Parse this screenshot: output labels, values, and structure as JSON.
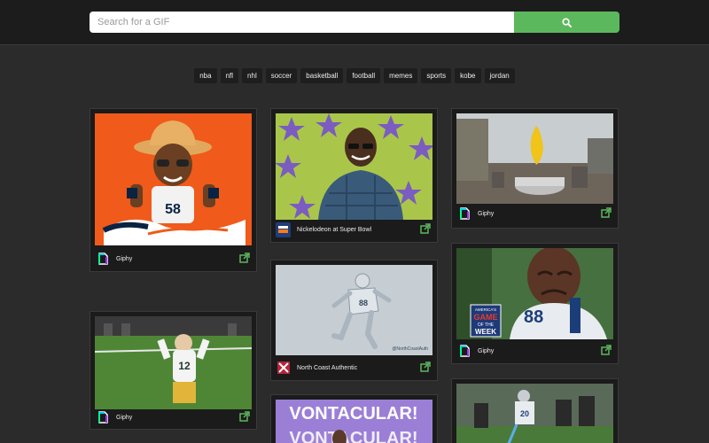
{
  "search": {
    "placeholder": "Search for a GIF",
    "button_icon": "search-icon"
  },
  "tags": [
    "nba",
    "nfl",
    "nhl",
    "soccer",
    "basketball",
    "football",
    "memes",
    "sports",
    "kobe",
    "jordan"
  ],
  "cards": [
    {
      "source": "Giphy",
      "source_icon": "giphy-logo-icon",
      "share_icon": "external-link-icon",
      "jersey": "58"
    },
    {
      "source": "Giphy",
      "source_icon": "giphy-logo-icon",
      "share_icon": "external-link-icon",
      "jersey": "12"
    },
    {
      "source": "Nickelodeon at Super Bowl",
      "source_icon": "nickelodeon-logo-icon",
      "share_icon": "external-link-icon"
    },
    {
      "source": "North Coast Authentic",
      "source_icon": "north-coast-logo-icon",
      "share_icon": "external-link-icon",
      "caption_text": "@NorthCoastAuth"
    },
    {
      "headline": "VONTACULAR!",
      "headline_echo": "VONTACULAR!"
    },
    {
      "source": "Giphy",
      "source_icon": "giphy-logo-icon",
      "share_icon": "external-link-icon"
    },
    {
      "source": "Giphy",
      "source_icon": "giphy-logo-icon",
      "share_icon": "external-link-icon",
      "jersey": "88",
      "badge_line1": "AMERICA'S",
      "badge_line2": "GAME",
      "badge_line3": "OF THE",
      "badge_line4": "WEEK"
    },
    {
      "jersey": "20"
    }
  ],
  "colors": {
    "accent": "#5cb85c",
    "background": "#2b2b2b",
    "card": "#1b1b1b",
    "topbar": "#1c1c1c"
  }
}
